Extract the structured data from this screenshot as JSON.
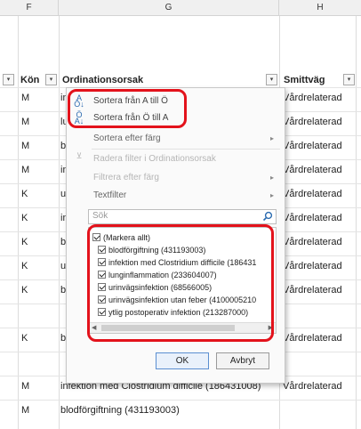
{
  "columns": {
    "f": "F",
    "g": "G",
    "h": "H"
  },
  "header": {
    "kon": "Kön",
    "ordinationsorsak": "Ordinationsorsak",
    "smittvag": "Smittväg"
  },
  "rows": [
    {
      "kon": "M",
      "ord": "in",
      "smitt": "Vårdrelaterad"
    },
    {
      "kon": "M",
      "ord": "lu",
      "smitt": "Vårdrelaterad"
    },
    {
      "kon": "M",
      "ord": "bl",
      "smitt": "Vårdrelaterad"
    },
    {
      "kon": "M",
      "ord": "in",
      "smitt": "Vårdrelaterad"
    },
    {
      "kon": "K",
      "ord": "ur",
      "smitt": "Vårdrelaterad"
    },
    {
      "kon": "K",
      "ord": "in",
      "smitt": "Vårdrelaterad"
    },
    {
      "kon": "K",
      "ord": "bl",
      "smitt": "Vårdrelaterad"
    },
    {
      "kon": "K",
      "ord": "ur",
      "smitt": "Vårdrelaterad"
    },
    {
      "kon": "K",
      "ord": "bl",
      "smitt": "Vårdrelaterad"
    },
    {
      "kon": "K",
      "ord": "bl",
      "smitt": "Vårdrelaterad"
    },
    {
      "kon": "M",
      "ord": "infektion med Clostridium difficile (186431008)",
      "smitt": "Vårdrelaterad"
    },
    {
      "kon": "M",
      "ord": "blodförgiftning (431193003)",
      "smitt": ""
    }
  ],
  "menu": {
    "sort_asc": "Sortera från A till Ö",
    "sort_desc": "Sortera från Ö till A",
    "sort_color": "Sortera efter färg",
    "clear_filter": "Radera filter i Ordinationsorsak",
    "filter_color": "Filtrera efter färg",
    "text_filter": "Textfilter",
    "search_placeholder": "Sök",
    "items": [
      "(Markera allt)",
      "blodförgiftning (431193003)",
      "infektion med Clostridium difficile (186431",
      "lunginflammation (233604007)",
      "urinvägsinfektion (68566005)",
      "urinvägsinfektion utan feber (4100005210",
      "ytlig postoperativ infektion (213287000)"
    ],
    "ok": "OK",
    "cancel": "Avbryt"
  },
  "icons": [
    "sort-ascending-icon",
    "sort-descending-icon",
    "clear-filter-icon",
    "search-icon",
    "filter-dropdown-icon",
    "checkbox-checked-icon"
  ],
  "colors": {
    "highlight": "#e3121b",
    "sort_icon": "#2b6bb0"
  }
}
